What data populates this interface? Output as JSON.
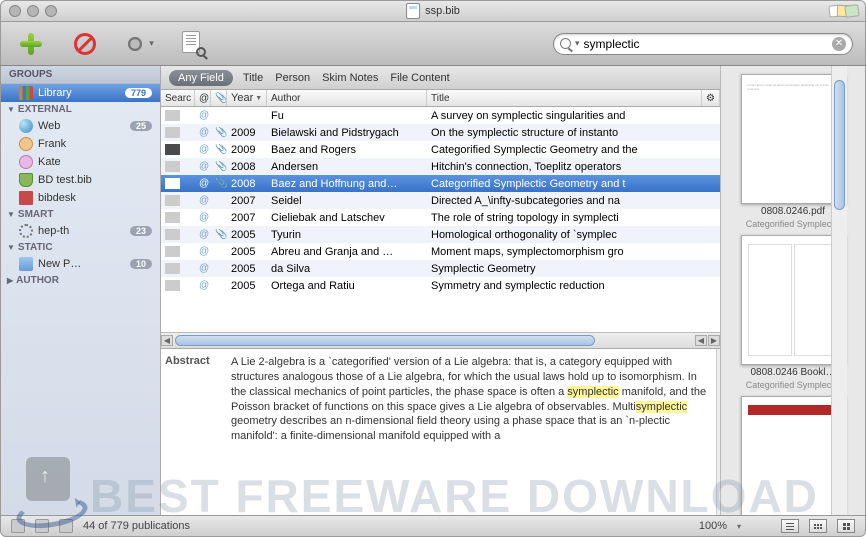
{
  "window": {
    "filename": "ssp.bib"
  },
  "toolbar": {
    "search_value": "symplectic"
  },
  "sidebar": {
    "groups_header": "GROUPS",
    "library": {
      "label": "Library",
      "count": "779"
    },
    "sections": [
      {
        "label": "EXTERNAL",
        "open": true,
        "items": [
          {
            "label": "Web",
            "count": "25",
            "icon": "globe"
          },
          {
            "label": "Frank",
            "icon": "person-o"
          },
          {
            "label": "Kate",
            "icon": "person-p"
          },
          {
            "label": "BD test.bib",
            "icon": "db"
          },
          {
            "label": "bibdesk",
            "icon": "book"
          }
        ]
      },
      {
        "label": "SMART",
        "open": true,
        "items": [
          {
            "label": "hep-th",
            "count": "23",
            "icon": "gear-s"
          }
        ]
      },
      {
        "label": "STATIC",
        "open": true,
        "items": [
          {
            "label": "New P…",
            "count": "10",
            "icon": "folder"
          }
        ]
      },
      {
        "label": "AUTHOR",
        "open": false,
        "items": []
      }
    ]
  },
  "scope": {
    "active": "Any Field",
    "items": [
      "Title",
      "Person",
      "Skim Notes",
      "File Content"
    ]
  },
  "columns": {
    "search": "Searc",
    "at": "@",
    "year": "Year",
    "author": "Author",
    "title": "Title"
  },
  "rows": [
    {
      "rank": 0,
      "at": "@",
      "clip": "",
      "year": "",
      "author": "Fu",
      "title": "A survey on symplectic singularities and"
    },
    {
      "rank": 0,
      "at": "@",
      "clip": "📎",
      "year": "2009",
      "author": "Bielawski and Pidstrygach",
      "title": "On the symplectic structure of instanto"
    },
    {
      "rank": 5,
      "at": "@",
      "clip": "📎",
      "year": "2009",
      "author": "Baez and Rogers",
      "title": "Categorified Symplectic Geometry and the"
    },
    {
      "rank": 0,
      "at": "@",
      "clip": "📎",
      "year": "2008",
      "author": "Andersen",
      "title": "Hitchin's connection, Toeplitz operators"
    },
    {
      "rank": 5,
      "at": "@",
      "clip": "📎",
      "year": "2008",
      "author": "Baez and Hoffnung and…",
      "title": "Categorified Symplectic Geometry and t",
      "selected": true
    },
    {
      "rank": 0,
      "at": "@",
      "clip": "",
      "year": "2007",
      "author": "Seidel",
      "title": "Directed A_\\infty-subcategories and na"
    },
    {
      "rank": 0,
      "at": "@",
      "clip": "",
      "year": "2007",
      "author": "Cieliebak and Latschev",
      "title": "The role of string topology in symplecti"
    },
    {
      "rank": 0,
      "at": "@",
      "clip": "📎",
      "year": "2005",
      "author": "Tyurin",
      "title": "Homological orthogonality of `symplec"
    },
    {
      "rank": 0,
      "at": "@",
      "clip": "",
      "year": "2005",
      "author": "Abreu and Granja and …",
      "title": "Moment maps, symplectomorphism gro"
    },
    {
      "rank": 0,
      "at": "@",
      "clip": "",
      "year": "2005",
      "author": "da Silva",
      "title": "Symplectic Geometry"
    },
    {
      "rank": 0,
      "at": "@",
      "clip": "",
      "year": "2005",
      "author": "Ortega and Ratiu",
      "title": "Symmetry and symplectic reduction"
    }
  ],
  "abstract": {
    "label": "Abstract",
    "text_a": "A Lie 2-algebra is a `categorified' version of a Lie algebra: that is, a category equipped with structures analogous those of a Lie algebra, for which the usual laws hold up to isomorphism. In the classical mechanics of point particles, the phase space is often a ",
    "hl1": "symplectic",
    "text_b": " manifold, and the Poisson bracket of functions on this space gives a Lie algebra of observables. Multi",
    "hl2": "symplectic",
    "text_c": " geometry describes an n-dimensional field theory using a phase space that is an `n-plectic manifold': a finite-dimensional manifold equipped with a"
  },
  "previews": [
    {
      "title": "0808.0246.pdf",
      "subtitle": "Categorified Symplec…",
      "type": "doc"
    },
    {
      "title": "0808.0246 Bookl…",
      "subtitle": "Categorified Symplec…",
      "type": "double"
    },
    {
      "title": "",
      "subtitle": "",
      "type": "web"
    }
  ],
  "status": {
    "count": "44 of 779 publications",
    "zoom": "100%"
  },
  "watermark": "BEST FREEWARE DOWNLOAD"
}
